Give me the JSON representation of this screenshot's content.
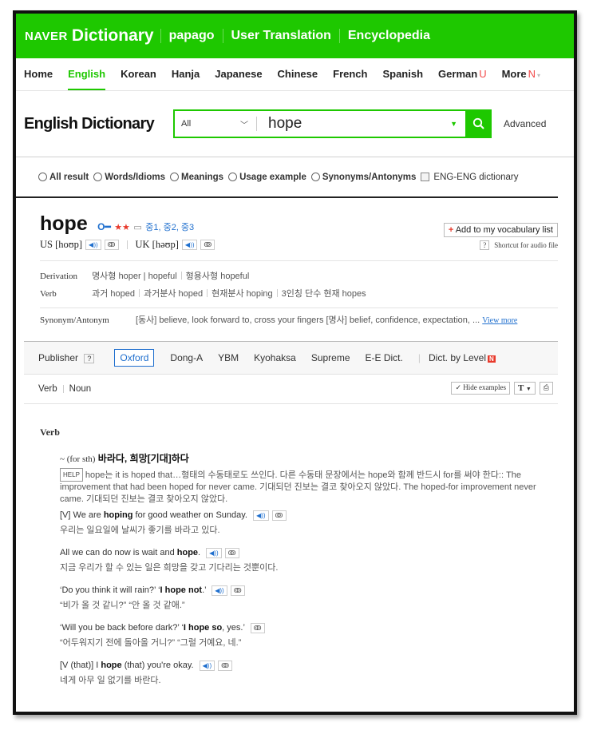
{
  "topbar": {
    "brand": "NAVER",
    "dictionary": "Dictionary",
    "links": [
      "papago",
      "User Translation",
      "Encyclopedia"
    ]
  },
  "nav": {
    "items": [
      "Home",
      "English",
      "Korean",
      "Hanja",
      "Japanese",
      "Chinese",
      "French",
      "Spanish",
      "German",
      "More"
    ],
    "badges": {
      "german": "U",
      "more": "N"
    },
    "active": "English"
  },
  "search": {
    "title": "English Dictionary",
    "scope": "All",
    "query": "hope",
    "advanced": "Advanced"
  },
  "filters": [
    "All result",
    "Words/Idioms",
    "Meanings",
    "Usage example",
    "Synonyms/Antonyms",
    "ENG-ENG dictionary"
  ],
  "entry": {
    "word": "hope",
    "key_icon": "key-icon",
    "stars": "★★",
    "level": "중1, 중2, 중3",
    "add_vocab": "Add to my vocabulary list",
    "us_label": "US [hoʊp]",
    "uk_label": "UK [həʊp]",
    "shortcut": "Shortcut for audio file",
    "derivation_label": "Derivation",
    "derivation_1": "명사형 hoper | hopeful",
    "derivation_2": "형용사형 hopeful",
    "verb_label": "Verb",
    "verb_forms": [
      "과거 hoped",
      "과거분사 hoped",
      "현재분사 hoping",
      "3인칭 단수 현재 hopes"
    ],
    "synonym_label": "Synonym/Antonym",
    "synonym_text": "[동사] believe, look forward to, cross your fingers [명사] belief, confidence, expectation, ...",
    "view_more_1": "View",
    "view_more_2": "more"
  },
  "publishers": {
    "label": "Publisher",
    "items": [
      "Oxford",
      "Dong-A",
      "YBM",
      "Kyohaksa",
      "Supreme",
      "E-E Dict.",
      "Dict. by Level"
    ],
    "level_badge": "N"
  },
  "pos_tabs": [
    "Verb",
    "Noun"
  ],
  "tools": {
    "hide_examples": "Hide examples",
    "text_size": "T"
  },
  "definition": {
    "pos": "Verb",
    "gram": "~ (for sth)",
    "meaning": "바라다, 희망[기대]하다",
    "help_tag": "HELP",
    "help_text_1": "hope는 it is hoped that…형태의 수동태로도 쓰인다. 다른 수동태 문장에서는 hope와 함께 반드시 for를 써야 한다:: The improvement that had been hoped for never came. 기대되던 진보는 결코 찾아오지 않았다. The hoped-for improvement never came. 기대되던 진보는 결코 찾아오지 않았다.",
    "examples": [
      {
        "pre": "[V] We are ",
        "bold": "hoping",
        "post": " for good weather on Sunday.",
        "ko": "우리는 일요일에 날씨가 좋기를 바라고 있다."
      },
      {
        "pre": "All we can do now is wait and ",
        "bold": "hope",
        "post": ".",
        "ko": "지금 우리가 할 수 있는 일은 희망을 갖고 기다리는 것뿐이다."
      },
      {
        "pre": "‘Do you think it will rain?’ ‘",
        "bold": "I hope not",
        "post": ".’",
        "ko": "“비가 올 것 같니?” “안 올 것 같애.”"
      },
      {
        "pre": "‘Will you be back before dark?’ ‘",
        "bold": "I hope so",
        "post": ", yes.’",
        "ko": "“어두워지기 전에 돌아올 거니?” “그럴 거예요, 네.”"
      },
      {
        "pre": "[V (that)] I ",
        "bold": "hope",
        "post": " (that) you're okay.",
        "ko": "네게 아무 일 없기를 바란다."
      }
    ]
  }
}
